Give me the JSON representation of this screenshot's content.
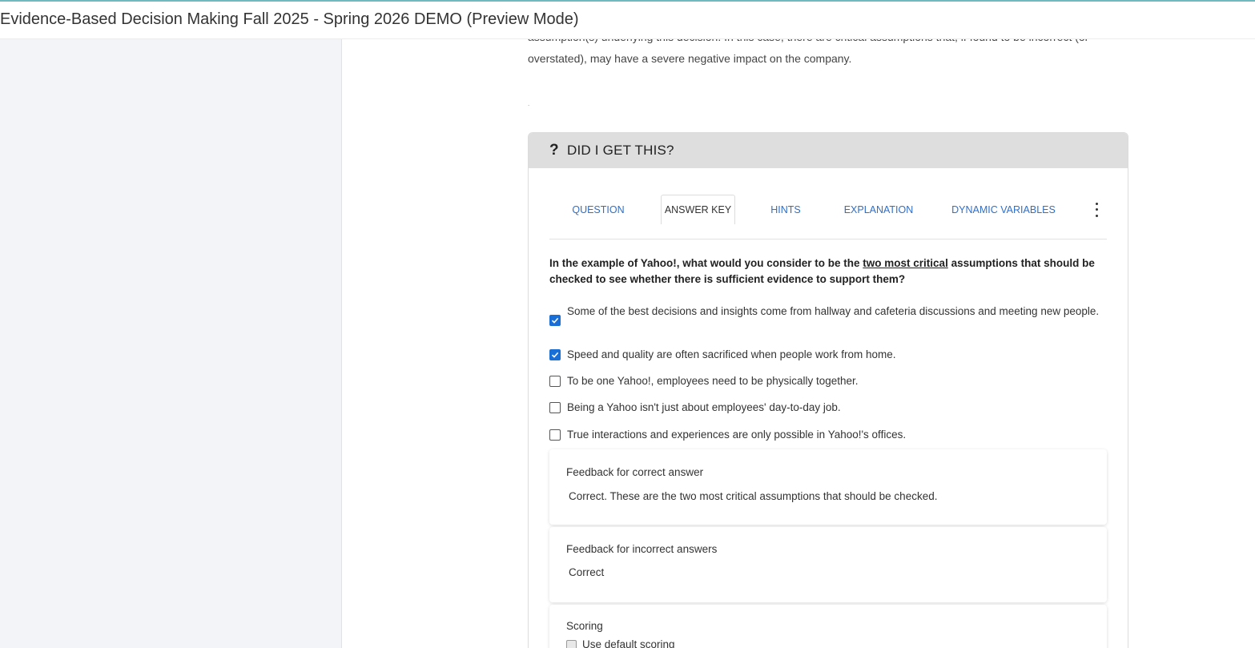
{
  "header": {
    "title": "Evidence-Based Decision Making Fall 2025 - Spring 2026 DEMO (Preview Mode)"
  },
  "intro": {
    "line1": "assumption(s) underlying this decision. In this case, there are critical assumptions that, if found to be incorrect (or",
    "line2": "overstated), may have a severe negative impact on the company.",
    "dot": "."
  },
  "card": {
    "icon": "?",
    "title": "DID I GET THIS?",
    "tabs": [
      {
        "label": "QUESTION"
      },
      {
        "label": "ANSWER KEY",
        "active": true
      },
      {
        "label": "HINTS"
      },
      {
        "label": "EXPLANATION"
      },
      {
        "label": "DYNAMIC VARIABLES"
      }
    ],
    "question": {
      "part1": "In the example of Yahoo!, what would you consider to be the ",
      "emphasis": "two most critical",
      "part2": " assumptions that should be checked to see whether there is sufficient evidence to support them?"
    },
    "choices": [
      {
        "text": "Some of the best decisions and insights come from hallway and cafeteria discussions and meeting new people.",
        "checked": true
      },
      {
        "text": "Speed and quality are often sacrificed when people work from home.",
        "checked": true
      },
      {
        "text": "To be one Yahoo!, employees need to be physically together.",
        "checked": false
      },
      {
        "text": "Being a Yahoo isn't just about employees' day-to-day job.",
        "checked": false
      },
      {
        "text": "True interactions and experiences are only possible in Yahoo!'s offices.",
        "checked": false
      }
    ],
    "feedback_correct": {
      "label": "Feedback for correct answer",
      "text": "Correct. These are the two most critical assumptions that should be checked."
    },
    "feedback_incorrect": {
      "label": "Feedback for incorrect answers",
      "text": "Correct"
    },
    "scoring": {
      "label": "Scoring",
      "default_label": "Use default scoring"
    }
  },
  "colors": {
    "accent": "#1a6fd6",
    "link": "#2f6fc9",
    "sidebar": "#f3f4f8",
    "card_header": "#dedede"
  },
  "icons": {
    "more": "vertical-dots-icon",
    "check": "check-icon",
    "question": "question-mark-icon"
  }
}
